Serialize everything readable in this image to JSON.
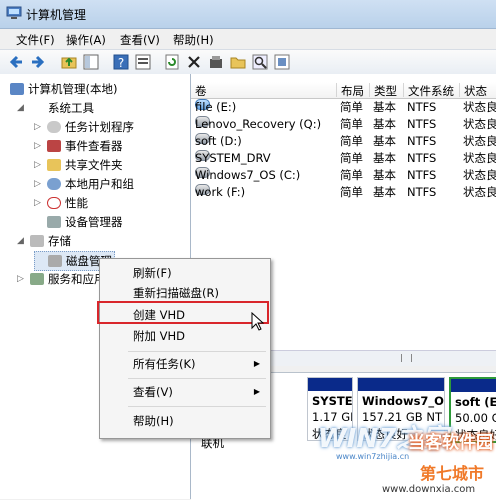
{
  "window": {
    "title": "计算机管理"
  },
  "menubar": [
    "文件(F)",
    "操作(A)",
    "查看(V)",
    "帮助(H)"
  ],
  "toolbar": {
    "icons": [
      "back-icon",
      "forward-icon",
      "up-folder-icon",
      "show-hide-tree-icon",
      "help-icon",
      "properties-icon",
      "refresh-icon",
      "delete-icon",
      "open-icon",
      "folder-icon",
      "search-icon",
      "settings-icon"
    ]
  },
  "tree": {
    "root": "计算机管理(本地)",
    "system_tools": "系统工具",
    "task_scheduler": "任务计划程序",
    "event_viewer": "事件查看器",
    "shared_folders": "共享文件夹",
    "local_users": "本地用户和组",
    "performance": "性能",
    "device_manager": "设备管理器",
    "storage": "存储",
    "disk_management": "磁盘管理",
    "services": "服务和应用"
  },
  "volumes": {
    "columns": [
      "卷",
      "布局",
      "类型",
      "文件系统",
      "状态"
    ],
    "rows": [
      {
        "name": "file (E:)",
        "layout": "简单",
        "type": "基本",
        "fs": "NTFS",
        "status": "状态良"
      },
      {
        "name": "Lenovo_Recovery (Q:)",
        "layout": "简单",
        "type": "基本",
        "fs": "NTFS",
        "status": "状态良"
      },
      {
        "name": "soft (D:)",
        "layout": "简单",
        "type": "基本",
        "fs": "NTFS",
        "status": "状态良"
      },
      {
        "name": "SYSTEM_DRV",
        "layout": "简单",
        "type": "基本",
        "fs": "NTFS",
        "status": "状态良"
      },
      {
        "name": "Windows7_OS (C:)",
        "layout": "简单",
        "type": "基本",
        "fs": "NTFS",
        "status": "状态良"
      },
      {
        "name": "work (F:)",
        "layout": "简单",
        "type": "基本",
        "fs": "NTFS",
        "status": "状态良"
      }
    ]
  },
  "disk_view": {
    "online_label": "联机",
    "partitions": [
      {
        "name": "SYSTEI",
        "size": "1.17 GI",
        "status": "状态良"
      },
      {
        "name": "Windows7_O",
        "size": "157.21 GB NT",
        "status": "状态良好"
      },
      {
        "name": "soft (E",
        "size": "50.00 G",
        "status": "状态良好"
      }
    ]
  },
  "context_menu": {
    "refresh": "刷新(F)",
    "rescan": "重新扫描磁盘(R)",
    "create_vhd": "创建 VHD",
    "attach_vhd": "附加 VHD",
    "all_tasks": "所有任务(K)",
    "view": "查看(V)",
    "help": "帮助(H)"
  },
  "watermark": {
    "logo": "WIN7之家",
    "url": "www.win7zhijia.cn",
    "brand": "当客软件园",
    "corner": "www.downxia.com",
    "cn_text": "第七城市"
  },
  "colors": {
    "accent_red": "#d9262b",
    "partition_bar": "#0a2a8a",
    "partition_bar_selected": "#2e9a3a"
  }
}
